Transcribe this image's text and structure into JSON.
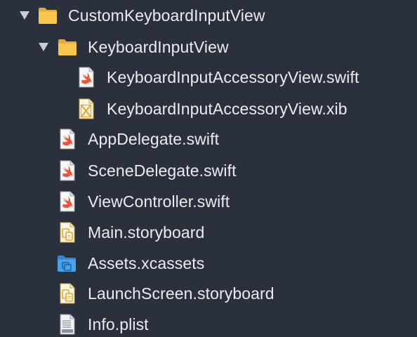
{
  "tree": {
    "root_folder": {
      "label": "CustomKeyboardInputView",
      "icon": "folder-icon",
      "expanded": true
    },
    "subfolder": {
      "label": "KeyboardInputView",
      "icon": "folder-icon",
      "expanded": true
    },
    "items": [
      {
        "label": "KeyboardInputAccessoryView.swift",
        "icon": "swift-file-icon"
      },
      {
        "label": "KeyboardInputAccessoryView.xib",
        "icon": "xib-file-icon"
      },
      {
        "label": "AppDelegate.swift",
        "icon": "swift-file-icon"
      },
      {
        "label": "SceneDelegate.swift",
        "icon": "swift-file-icon"
      },
      {
        "label": "ViewController.swift",
        "icon": "swift-file-icon"
      },
      {
        "label": "Main.storyboard",
        "icon": "storyboard-file-icon"
      },
      {
        "label": "Assets.xcassets",
        "icon": "assets-folder-icon"
      },
      {
        "label": "LaunchScreen.storyboard",
        "icon": "storyboard-file-icon"
      },
      {
        "label": "Info.plist",
        "icon": "plist-file-icon"
      }
    ]
  },
  "colors": {
    "background": "#2b313c",
    "text": "#e9ecf1",
    "folder": "#f7c64a",
    "swift": "#f0513a",
    "assets_folder": "#4aa3e8"
  }
}
